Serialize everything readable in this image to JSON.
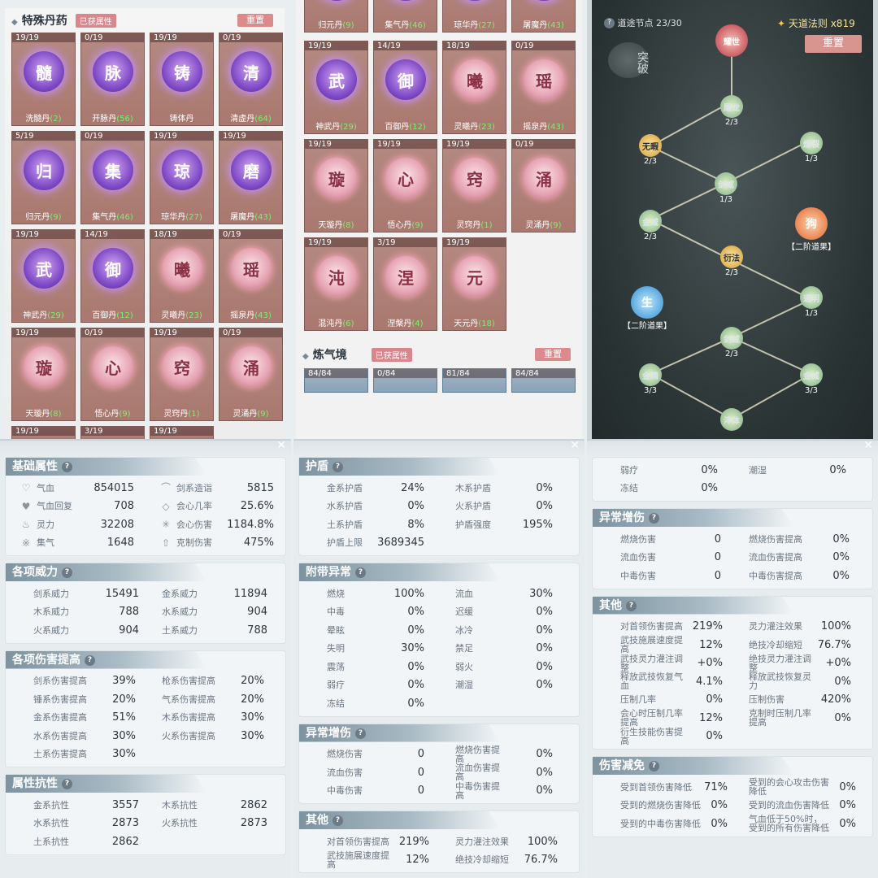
{
  "pill_panel_left": {
    "title": "特殊丹药",
    "tag": "已获属性",
    "reset": "重置",
    "cards": [
      {
        "count": "19/19",
        "glyph": "髓",
        "name": "洗髓丹",
        "bonus": "(2)",
        "style": "p"
      },
      {
        "count": "0/19",
        "glyph": "脉",
        "name": "开脉丹",
        "bonus": "(56)",
        "style": "p"
      },
      {
        "count": "19/19",
        "glyph": "铸",
        "name": "铸体丹",
        "bonus": "",
        "style": "p"
      },
      {
        "count": "0/19",
        "glyph": "清",
        "name": "清虚丹",
        "bonus": "(64)",
        "style": "p"
      },
      {
        "count": "5/19",
        "glyph": "归",
        "name": "归元丹",
        "bonus": "(9)",
        "style": "p"
      },
      {
        "count": "0/19",
        "glyph": "集",
        "name": "集气丹",
        "bonus": "(46)",
        "style": "p"
      },
      {
        "count": "19/19",
        "glyph": "琼",
        "name": "琼华丹",
        "bonus": "(27)",
        "style": "p"
      },
      {
        "count": "19/19",
        "glyph": "磨",
        "name": "屠魔丹",
        "bonus": "(43)",
        "style": "p"
      },
      {
        "count": "19/19",
        "glyph": "武",
        "name": "神武丹",
        "bonus": "(29)",
        "style": "p"
      },
      {
        "count": "14/19",
        "glyph": "御",
        "name": "百御丹",
        "bonus": "(12)",
        "style": "p"
      },
      {
        "count": "18/19",
        "glyph": "曦",
        "name": "灵曦丹",
        "bonus": "(23)",
        "style": "k"
      },
      {
        "count": "0/19",
        "glyph": "瑶",
        "name": "摇泉丹",
        "bonus": "(43)",
        "style": "k"
      },
      {
        "count": "19/19",
        "glyph": "璇",
        "name": "天璇丹",
        "bonus": "(8)",
        "style": "k"
      },
      {
        "count": "0/19",
        "glyph": "心",
        "name": "悟心丹",
        "bonus": "(9)",
        "style": "k"
      },
      {
        "count": "19/19",
        "glyph": "窍",
        "name": "灵窍丹",
        "bonus": "(1)",
        "style": "k"
      },
      {
        "count": "0/19",
        "glyph": "涌",
        "name": "灵涌丹",
        "bonus": "(9)",
        "style": "k"
      }
    ],
    "partial_counts": [
      "19/19",
      "3/19",
      "19/19"
    ]
  },
  "pill_panel_mid": {
    "top_cards": [
      {
        "glyph": "归",
        "name": "归元丹",
        "bonus": "(9)",
        "style": "p"
      },
      {
        "glyph": "集",
        "name": "集气丹",
        "bonus": "(46)",
        "style": "p"
      },
      {
        "glyph": "琼",
        "name": "琼华丹",
        "bonus": "(27)",
        "style": "p"
      },
      {
        "glyph": "磨",
        "name": "屠魔丹",
        "bonus": "(43)",
        "style": "p"
      }
    ],
    "cards": [
      {
        "count": "19/19",
        "glyph": "武",
        "name": "神武丹",
        "bonus": "(29)",
        "style": "p"
      },
      {
        "count": "14/19",
        "glyph": "御",
        "name": "百御丹",
        "bonus": "(12)",
        "style": "p"
      },
      {
        "count": "18/19",
        "glyph": "曦",
        "name": "灵曦丹",
        "bonus": "(23)",
        "style": "k"
      },
      {
        "count": "0/19",
        "glyph": "瑶",
        "name": "摇泉丹",
        "bonus": "(43)",
        "style": "k"
      },
      {
        "count": "19/19",
        "glyph": "璇",
        "name": "天璇丹",
        "bonus": "(8)",
        "style": "k"
      },
      {
        "count": "19/19",
        "glyph": "心",
        "name": "悟心丹",
        "bonus": "(9)",
        "style": "k"
      },
      {
        "count": "19/19",
        "glyph": "窍",
        "name": "灵窍丹",
        "bonus": "(1)",
        "style": "k"
      },
      {
        "count": "0/19",
        "glyph": "涌",
        "name": "灵涌丹",
        "bonus": "(9)",
        "style": "k"
      },
      {
        "count": "19/19",
        "glyph": "沌",
        "name": "混沌丹",
        "bonus": "(6)",
        "style": "k"
      },
      {
        "count": "3/19",
        "glyph": "涅",
        "name": "涅槃丹",
        "bonus": "(4)",
        "style": "k"
      },
      {
        "count": "19/19",
        "glyph": "元",
        "name": "天元丹",
        "bonus": "(18)",
        "style": "k"
      }
    ],
    "sub_title": "炼气境",
    "sub_tag": "已获属性",
    "sub_reset": "重置",
    "sub_counts": [
      "84/84",
      "0/84",
      "81/84",
      "84/84"
    ]
  },
  "dao_tree": {
    "node_label": "道途节点 23/30",
    "currency": "天道法则 x819",
    "reset": "重置",
    "breakthrough": "突破",
    "nodes": [
      {
        "glyph": "耀世",
        "progress": "",
        "style": "r"
      },
      {
        "glyph": "屠龙",
        "progress": "2/3",
        "style": "g"
      },
      {
        "glyph": "无暇",
        "progress": "2/3",
        "style": "y"
      },
      {
        "glyph": "爆裂",
        "progress": "1/3",
        "style": "g"
      },
      {
        "glyph": "剑威",
        "progress": "1/3",
        "style": "g"
      },
      {
        "glyph": "金威",
        "progress": "2/3",
        "style": "g"
      },
      {
        "glyph": "狗",
        "progress": "【二阶道果】",
        "style": "o"
      },
      {
        "glyph": "衍法",
        "progress": "2/3",
        "style": "y"
      },
      {
        "glyph": "生",
        "progress": "【二阶道果】",
        "style": "b"
      },
      {
        "glyph": "通明",
        "progress": "1/3",
        "style": "g"
      },
      {
        "glyph": "剑威",
        "progress": "2/3",
        "style": "g"
      },
      {
        "glyph": "金精",
        "progress": "3/3",
        "style": "g"
      },
      {
        "glyph": "金威",
        "progress": "3/3",
        "style": "g"
      },
      {
        "glyph": "淬体",
        "progress": "",
        "style": "g"
      }
    ]
  },
  "stats_left": {
    "basic": {
      "title": "基础属性",
      "rows": [
        [
          {
            "icon": "♡",
            "k": "气血",
            "v": "854015"
          },
          {
            "icon": "⌒",
            "k": "剑系造诣",
            "v": "5815"
          }
        ],
        [
          {
            "icon": "♥",
            "k": "气血回复",
            "v": "708"
          },
          {
            "icon": "◇",
            "k": "会心几率",
            "v": "25.6%"
          }
        ],
        [
          {
            "icon": "♨",
            "k": "灵力",
            "v": "32208"
          },
          {
            "icon": "✳",
            "k": "会心伤害",
            "v": "1184.8%"
          }
        ],
        [
          {
            "icon": "※",
            "k": "集气",
            "v": "1648"
          },
          {
            "icon": "⇧",
            "k": "克制伤害",
            "v": "475%"
          }
        ]
      ]
    },
    "power": {
      "title": "各项威力",
      "rows": [
        [
          {
            "k": "剑系威力",
            "v": "15491"
          },
          {
            "k": "金系威力",
            "v": "11894"
          }
        ],
        [
          {
            "k": "木系威力",
            "v": "788"
          },
          {
            "k": "水系威力",
            "v": "904"
          }
        ],
        [
          {
            "k": "火系威力",
            "v": "904"
          },
          {
            "k": "土系威力",
            "v": "788"
          }
        ]
      ]
    },
    "dmg": {
      "title": "各项伤害提高",
      "rows": [
        [
          {
            "k": "剑系伤害提高",
            "v": "39%"
          },
          {
            "k": "枪系伤害提高",
            "v": "20%"
          }
        ],
        [
          {
            "k": "锤系伤害提高",
            "v": "20%"
          },
          {
            "k": "气系伤害提高",
            "v": "20%"
          }
        ],
        [
          {
            "k": "金系伤害提高",
            "v": "51%"
          },
          {
            "k": "木系伤害提高",
            "v": "30%"
          }
        ],
        [
          {
            "k": "水系伤害提高",
            "v": "30%"
          },
          {
            "k": "火系伤害提高",
            "v": "30%"
          }
        ],
        [
          {
            "k": "土系伤害提高",
            "v": "30%"
          },
          {
            "k": "",
            "v": ""
          }
        ]
      ]
    },
    "resist": {
      "title": "属性抗性",
      "rows": [
        [
          {
            "k": "金系抗性",
            "v": "3557"
          },
          {
            "k": "木系抗性",
            "v": "2862"
          }
        ],
        [
          {
            "k": "水系抗性",
            "v": "2873"
          },
          {
            "k": "火系抗性",
            "v": "2873"
          }
        ],
        [
          {
            "k": "土系抗性",
            "v": "2862"
          },
          {
            "k": "",
            "v": ""
          }
        ]
      ]
    }
  },
  "stats_mid": {
    "shield": {
      "title": "护盾",
      "rows": [
        [
          {
            "k": "金系护盾",
            "v": "24%"
          },
          {
            "k": "木系护盾",
            "v": "0%"
          }
        ],
        [
          {
            "k": "水系护盾",
            "v": "0%"
          },
          {
            "k": "火系护盾",
            "v": "0%"
          }
        ],
        [
          {
            "k": "土系护盾",
            "v": "8%"
          },
          {
            "k": "护盾强度",
            "v": "195%"
          }
        ],
        [
          {
            "k": "护盾上限",
            "v": "3689345"
          },
          {
            "k": "",
            "v": ""
          }
        ]
      ]
    },
    "abnormal": {
      "title": "附带异常",
      "rows": [
        [
          {
            "k": "燃烧",
            "v": "100%"
          },
          {
            "k": "流血",
            "v": "30%"
          }
        ],
        [
          {
            "k": "中毒",
            "v": "0%"
          },
          {
            "k": "迟缓",
            "v": "0%"
          }
        ],
        [
          {
            "k": "晕眩",
            "v": "0%"
          },
          {
            "k": "冰冷",
            "v": "0%"
          }
        ],
        [
          {
            "k": "失明",
            "v": "30%"
          },
          {
            "k": "禁足",
            "v": "0%"
          }
        ],
        [
          {
            "k": "震荡",
            "v": "0%"
          },
          {
            "k": "弱火",
            "v": "0%"
          }
        ],
        [
          {
            "k": "弱疗",
            "v": "0%"
          },
          {
            "k": "潮湿",
            "v": "0%"
          }
        ],
        [
          {
            "k": "冻结",
            "v": "0%"
          },
          {
            "k": "",
            "v": ""
          }
        ]
      ]
    },
    "abnormal_dmg": {
      "title": "异常增伤",
      "rows": [
        [
          {
            "k": "燃烧伤害",
            "v": "0"
          },
          {
            "k": "燃烧伤害提高",
            "v": "0%"
          }
        ],
        [
          {
            "k": "流血伤害",
            "v": "0"
          },
          {
            "k": "流血伤害提高",
            "v": "0%"
          }
        ],
        [
          {
            "k": "中毒伤害",
            "v": "0"
          },
          {
            "k": "中毒伤害提高",
            "v": "0%"
          }
        ]
      ]
    },
    "other": {
      "title": "其他",
      "rows": [
        [
          {
            "k": "对首领伤害提高",
            "v": "219%"
          },
          {
            "k": "灵力灌注效果",
            "v": "100%"
          }
        ],
        [
          {
            "k": "武技施展速度提高",
            "v": "12%"
          },
          {
            "k": "绝技冷却缩短",
            "v": "76.7%"
          }
        ]
      ]
    }
  },
  "stats_right": {
    "top": {
      "rows": [
        [
          {
            "k": "弱疗",
            "v": "0%"
          },
          {
            "k": "潮湿",
            "v": "0%"
          }
        ],
        [
          {
            "k": "冻结",
            "v": "0%"
          },
          {
            "k": "",
            "v": ""
          }
        ]
      ]
    },
    "abnormal_dmg": {
      "title": "异常增伤",
      "rows": [
        [
          {
            "k": "燃烧伤害",
            "v": "0"
          },
          {
            "k": "燃烧伤害提高",
            "v": "0%"
          }
        ],
        [
          {
            "k": "流血伤害",
            "v": "0"
          },
          {
            "k": "流血伤害提高",
            "v": "0%"
          }
        ],
        [
          {
            "k": "中毒伤害",
            "v": "0"
          },
          {
            "k": "中毒伤害提高",
            "v": "0%"
          }
        ]
      ]
    },
    "other": {
      "title": "其他",
      "rows": [
        [
          {
            "k": "对首领伤害提高",
            "v": "219%"
          },
          {
            "k": "灵力灌注效果",
            "v": "100%"
          }
        ],
        [
          {
            "k": "武技施展速度提高",
            "v": "12%"
          },
          {
            "k": "绝技冷却缩短",
            "v": "76.7%"
          }
        ],
        [
          {
            "k": "武技灵力灌注调整",
            "v": "+0%"
          },
          {
            "k": "绝技灵力灌注调整",
            "v": "+0%"
          }
        ],
        [
          {
            "k": "释放武技恢复气血",
            "v": "4.1%"
          },
          {
            "k": "释放武技恢复灵力",
            "v": "0%"
          }
        ],
        [
          {
            "k": "压制几率",
            "v": "0%"
          },
          {
            "k": "压制伤害",
            "v": "420%"
          }
        ],
        [
          {
            "k": "会心时压制几率提高",
            "v": "12%"
          },
          {
            "k": "克制时压制几率提高",
            "v": "0%"
          }
        ],
        [
          {
            "k": "衍生技能伤害提高",
            "v": "0%"
          },
          {
            "k": "",
            "v": ""
          }
        ]
      ]
    },
    "reduce": {
      "title": "伤害减免",
      "rows": [
        [
          {
            "k": "受到首领伤害降低",
            "v": "71%"
          },
          {
            "k": "受到的会心攻击伤害降低",
            "v": "0%"
          }
        ],
        [
          {
            "k": "受到的燃烧伤害降低",
            "v": "0%"
          },
          {
            "k": "受到的流血伤害降低",
            "v": "0%"
          }
        ],
        [
          {
            "k": "受到的中毒伤害降低",
            "v": "0%"
          },
          {
            "k": "气血低于50%时，受到的所有伤害降低",
            "v": "0%"
          }
        ]
      ]
    }
  }
}
